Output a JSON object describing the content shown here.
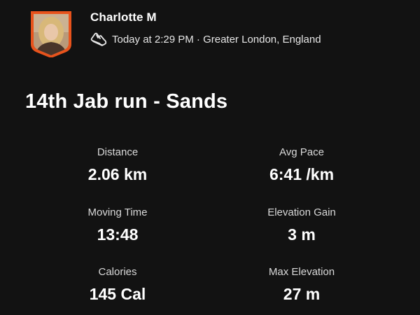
{
  "author": {
    "name": "Charlotte M",
    "timestamp": "Today at 2:29 PM",
    "separator": " · ",
    "location": "Greater London, England",
    "activity_icon": "running-shoe-icon"
  },
  "activity": {
    "title": "14th Jab run - Sands"
  },
  "stats": [
    {
      "label": "Distance",
      "value": "2.06 km"
    },
    {
      "label": "Avg Pace",
      "value": "6:41 /km"
    },
    {
      "label": "Moving Time",
      "value": "13:48"
    },
    {
      "label": "Elevation Gain",
      "value": "3 m"
    },
    {
      "label": "Calories",
      "value": "145 Cal"
    },
    {
      "label": "Max Elevation",
      "value": "27 m"
    }
  ],
  "colors": {
    "background": "#121212",
    "badge_orange": "#e8531c",
    "text_primary": "#ffffff",
    "text_secondary": "#d9d9d9"
  }
}
